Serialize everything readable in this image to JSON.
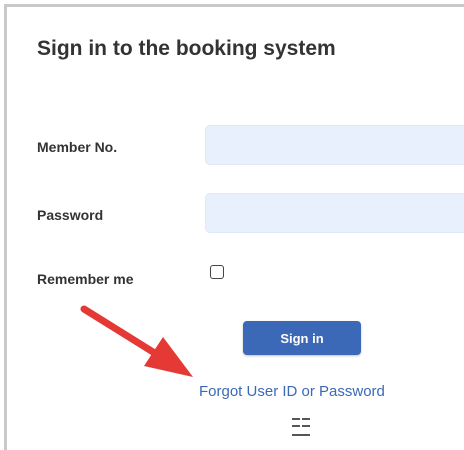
{
  "page": {
    "title": "Sign in to the booking system"
  },
  "form": {
    "member_label": "Member No.",
    "member_value": "",
    "password_label": "Password",
    "password_value": "",
    "remember_label": "Remember me",
    "remember_checked": false,
    "signin_label": "Sign in",
    "forgot_link": "Forgot User ID or Password"
  },
  "icons": {
    "menu": "menu-icon",
    "annotation": "red-arrow-icon"
  },
  "colors": {
    "accent": "#3b69b8",
    "field_bg": "#e8f0fe",
    "annotation": "#e53935",
    "text": "#333333"
  }
}
